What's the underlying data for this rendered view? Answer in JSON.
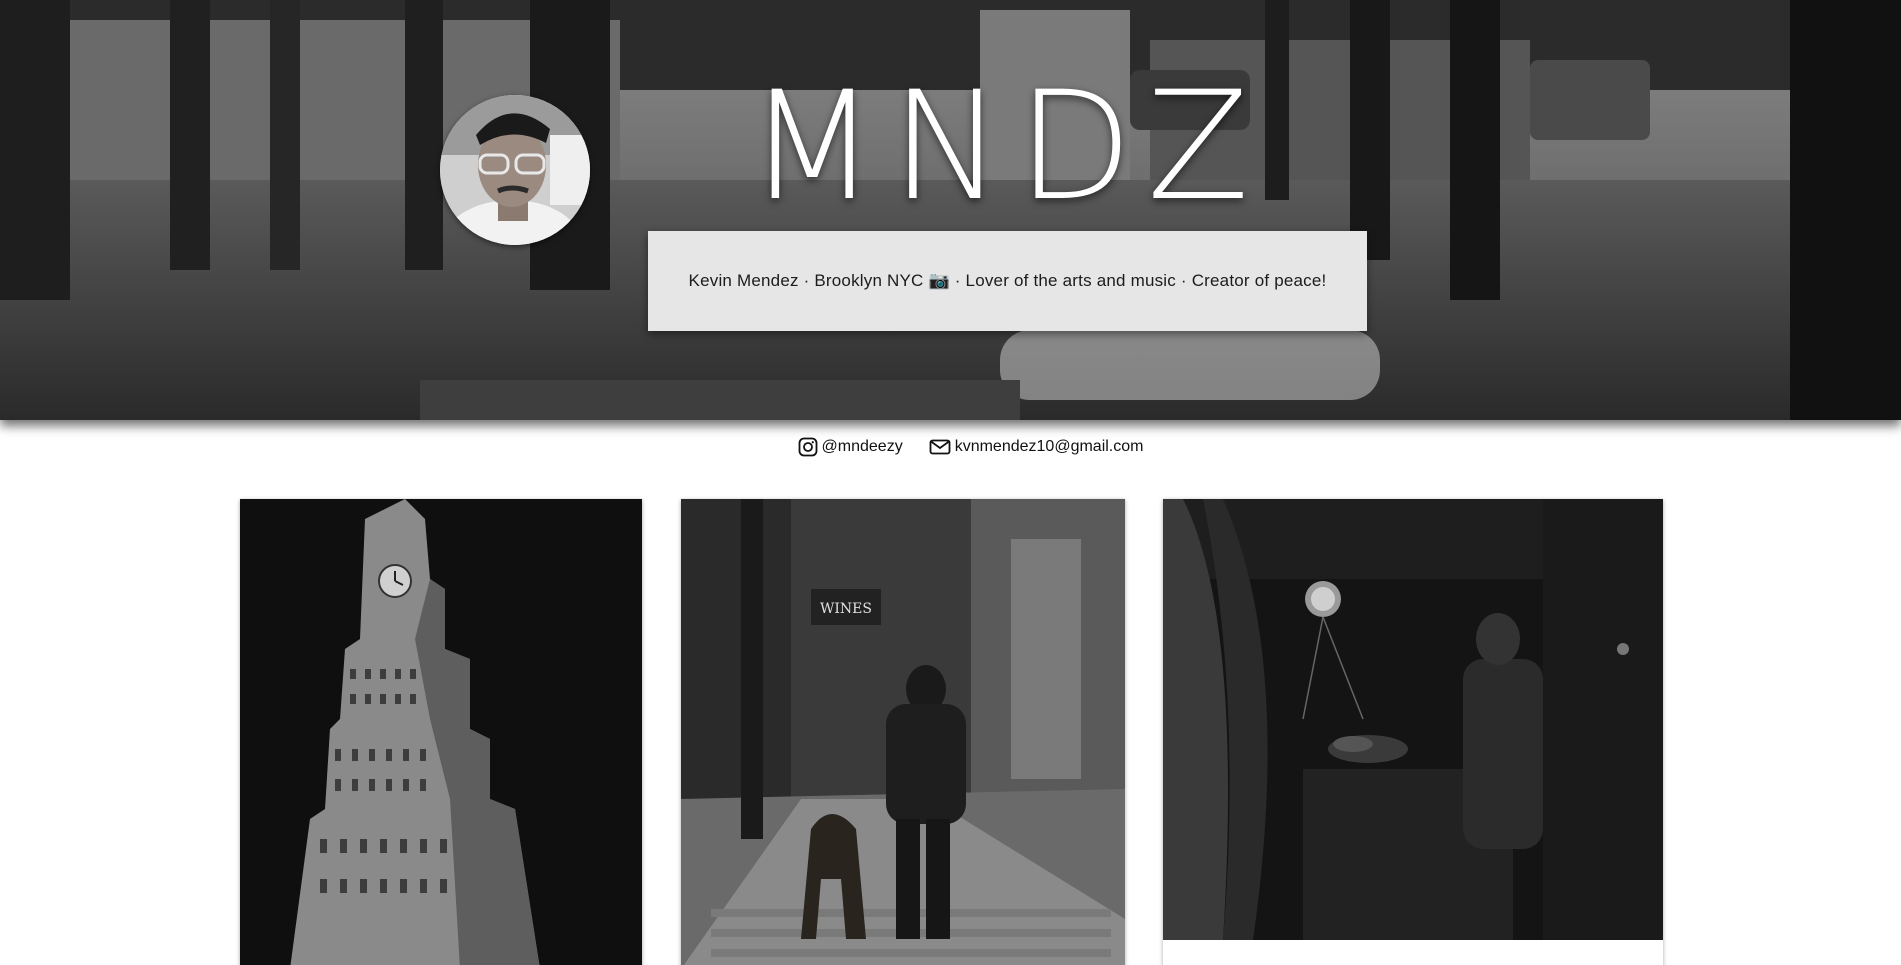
{
  "header": {
    "brand": "MNDZ",
    "bio": "Kevin Mendez · Brooklyn NYC 📷 · Lover of the arts and music · Creator of peace!"
  },
  "contacts": [
    {
      "icon": "instagram-icon",
      "label": "@mndeezy"
    },
    {
      "icon": "mail-icon",
      "label": "kvnmendez10@gmail.com"
    }
  ],
  "gallery": [
    {
      "subject": "clock-tower-skyscraper"
    },
    {
      "subject": "man-walking-dog-street"
    },
    {
      "subject": "street-vendor-market"
    }
  ]
}
